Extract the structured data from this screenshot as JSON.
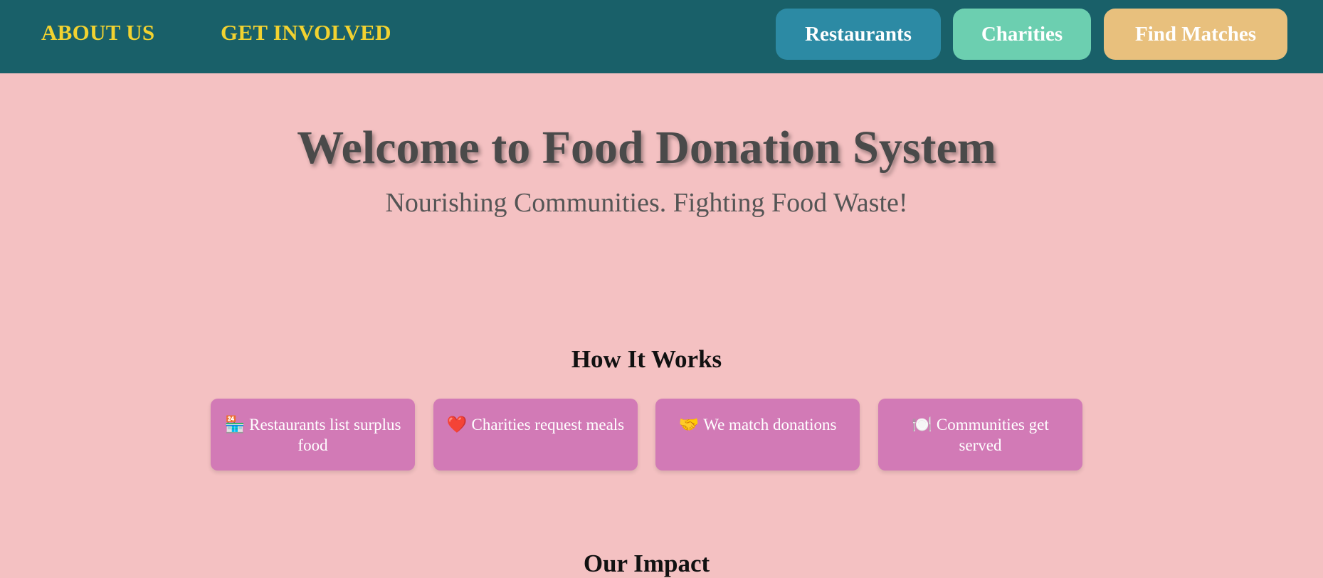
{
  "nav": {
    "about_label": "ABOUT US",
    "involved_label": "GET INVOLVED",
    "buttons": [
      {
        "label": "Restaurants",
        "color": "#2c8aa4"
      },
      {
        "label": "Charities",
        "color": "#6ccfb0"
      },
      {
        "label": "Find Matches",
        "color": "#e8c07d"
      }
    ]
  },
  "hero": {
    "title": "Welcome to Food Donation System",
    "subtitle": "Nourishing Communities. Fighting Food Waste!"
  },
  "how_it_works": {
    "title": "How It Works",
    "steps": [
      {
        "icon": "🏪",
        "icon_name": "store-icon",
        "text": "Restaurants list surplus food"
      },
      {
        "icon": "❤️",
        "icon_name": "heart-icon",
        "text": "Charities request meals"
      },
      {
        "icon": "🤝",
        "icon_name": "handshake-icon",
        "text": "We match donations"
      },
      {
        "icon": "🍽️",
        "icon_name": "plate-icon",
        "text": "Communities get served"
      }
    ]
  },
  "impact": {
    "title": "Our Impact"
  },
  "colors": {
    "topbar": "#196069",
    "nav_link": "#f2d230",
    "background": "#f4c1c2",
    "card": "#d27ab6"
  }
}
